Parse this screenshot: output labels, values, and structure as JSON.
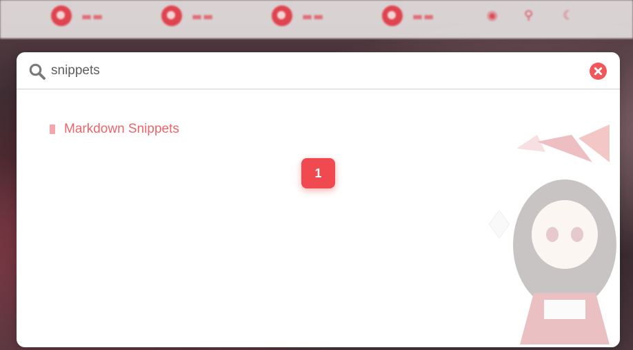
{
  "search": {
    "value": "snippets"
  },
  "results": [
    {
      "title": "Markdown Snippets"
    }
  ],
  "pagination": {
    "current_page": "1"
  },
  "icons": {
    "search": "search-icon",
    "close": "close-icon"
  },
  "colors": {
    "accent": "#f04a50",
    "link": "#ee6469"
  }
}
